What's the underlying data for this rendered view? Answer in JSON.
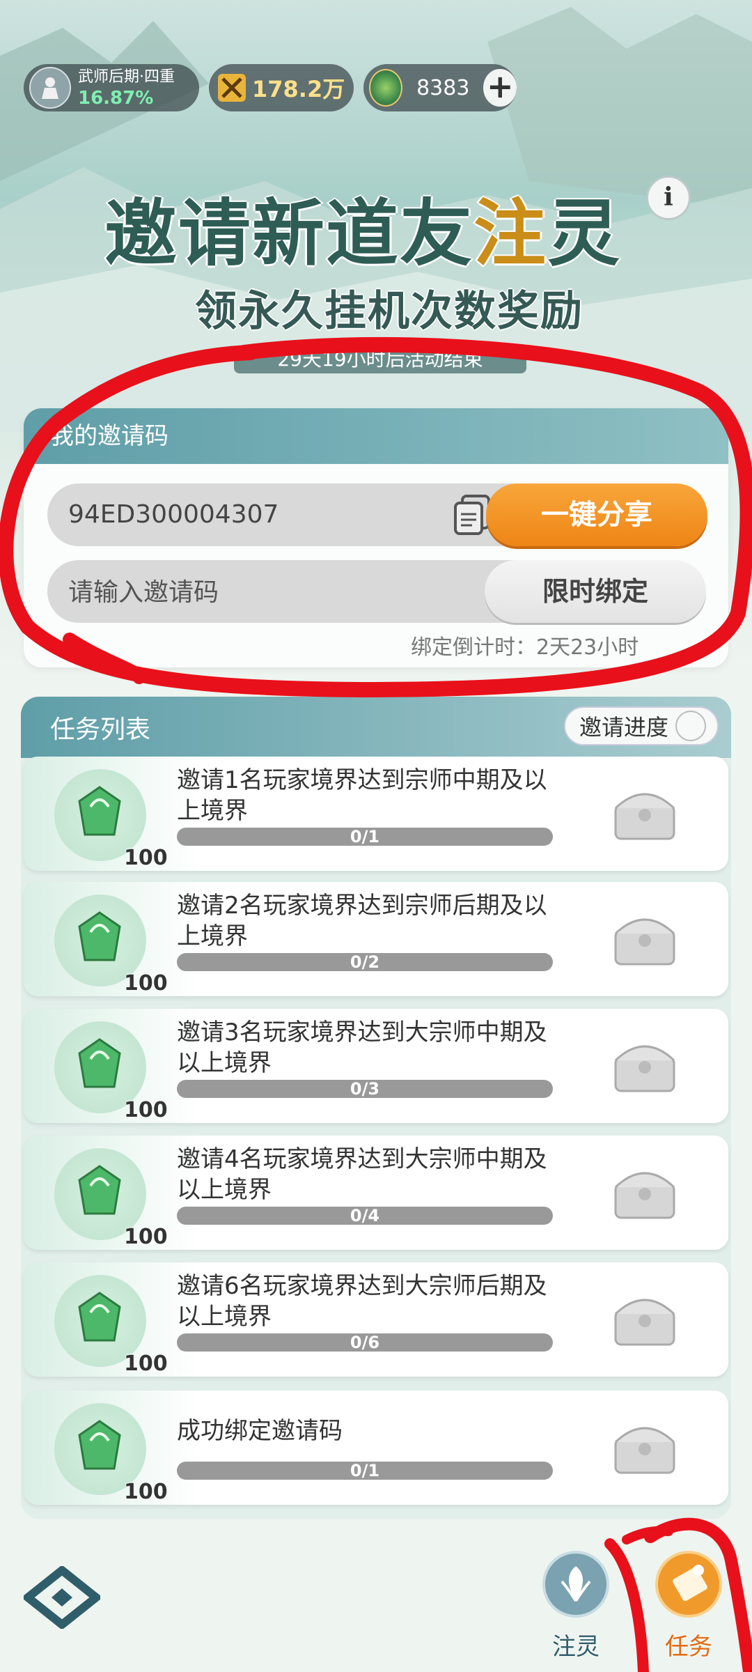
{
  "status_bar": {
    "rank_name": "武师后期·四重",
    "rank_percent": "16.87%",
    "power_value": "178.2万",
    "currency_value": "8383"
  },
  "title": {
    "main_part1": "邀请新道友",
    "main_highlight": "注",
    "main_part2": "灵",
    "subtitle": "领永久挂机次数奖励",
    "timer": "29天19小时后活动结束"
  },
  "invite_card": {
    "header": "我的邀请码",
    "code": "94ED300004307",
    "share_button": "一键分享",
    "input_placeholder": "请输入邀请码",
    "bind_button": "限时绑定",
    "countdown": "绑定倒计时：2天23小时"
  },
  "task_list": {
    "title": "任务列表",
    "progress_button": "邀请进度",
    "items": [
      {
        "name": "邀请1名玩家境界达到宗师中期及以上境界",
        "progress": "0/1",
        "reward": "100"
      },
      {
        "name": "邀请2名玩家境界达到宗师后期及以上境界",
        "progress": "0/2",
        "reward": "100"
      },
      {
        "name": "邀请3名玩家境界达到大宗师中期及以上境界",
        "progress": "0/3",
        "reward": "100"
      },
      {
        "name": "邀请4名玩家境界达到大宗师中期及以上境界",
        "progress": "0/4",
        "reward": "100"
      },
      {
        "name": "邀请6名玩家境界达到大宗师后期及以上境界",
        "progress": "0/6",
        "reward": "100"
      },
      {
        "name": "成功绑定邀请码",
        "progress": "0/1",
        "reward": "100"
      }
    ]
  },
  "bottom_nav": {
    "items": [
      {
        "label": "注灵",
        "icon": "leaf-icon"
      },
      {
        "label": "任务",
        "icon": "scroll-icon",
        "active": true
      }
    ]
  },
  "colors": {
    "accent_orange": "#ee8516",
    "header_teal": "#5f9ea8",
    "annotation_red": "#e8101a"
  }
}
